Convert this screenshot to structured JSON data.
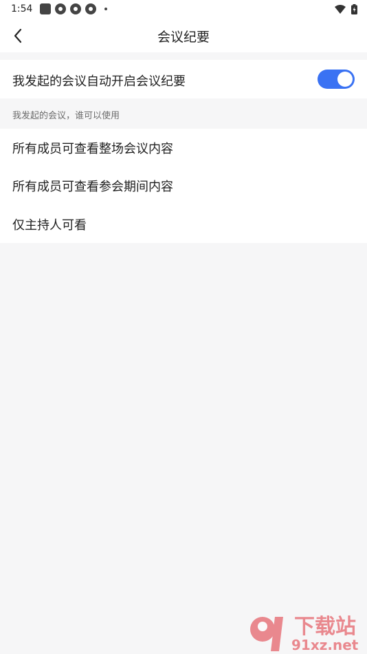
{
  "status_bar": {
    "time": "1:54"
  },
  "header": {
    "title": "会议纪要"
  },
  "auto_summary": {
    "label": "我发起的会议自动开启会议纪要",
    "enabled": true,
    "accent_color": "#3a72f3"
  },
  "section": {
    "caption": "我发起的会议，谁可以使用"
  },
  "options": [
    {
      "label": "所有成员可查看整场会议内容"
    },
    {
      "label": "所有成员可查看参会期间内容"
    },
    {
      "label": "仅主持人可看"
    }
  ],
  "watermark": {
    "site": "下载站",
    "domain": "91xz.net",
    "brand_color": "#e0303a"
  }
}
